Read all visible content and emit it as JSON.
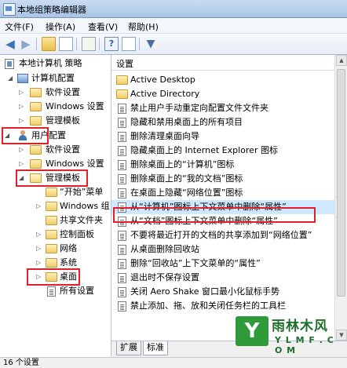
{
  "window": {
    "title": "本地组策略编辑器"
  },
  "menu": [
    "文件(F)",
    "操作(A)",
    "查看(V)",
    "帮助(H)"
  ],
  "toolbar": {
    "icons": [
      "back-arrow-icon",
      "forward-arrow-icon",
      "up-folder-icon",
      "show-hide-tree-icon",
      "export-list-icon",
      "help-icon",
      "properties-icon",
      "filter-icon"
    ]
  },
  "tree": {
    "root": "本地计算机 策略",
    "computer_config": "计算机配置",
    "cc_software": "软件设置",
    "cc_windows": "Windows 设置",
    "cc_admin": "管理模板",
    "user_config": "用户配置",
    "uc_software": "软件设置",
    "uc_windows": "Windows 设置",
    "uc_admin": "管理模板",
    "start_menu": "“开始”菜单",
    "windows_comp": "Windows 组",
    "shared_folders": "共享文件夹",
    "control_panel": "控制面板",
    "network": "网络",
    "system": "系统",
    "desktop": "桌面",
    "all_settings": "所有设置"
  },
  "list": {
    "header": "设置",
    "items": [
      {
        "label": "Active Desktop",
        "type": "folder"
      },
      {
        "label": "Active Directory",
        "type": "folder"
      },
      {
        "label": "禁止用户手动重定向配置文件文件夹",
        "type": "policy"
      },
      {
        "label": "隐藏和禁用桌面上的所有项目",
        "type": "policy"
      },
      {
        "label": "删除清理桌面向导",
        "type": "policy"
      },
      {
        "label": "隐藏桌面上的 Internet Explorer 图标",
        "type": "policy"
      },
      {
        "label": "删除桌面上的“计算机”图标",
        "type": "policy"
      },
      {
        "label": "删除桌面上的“我的文档”图标",
        "type": "policy"
      },
      {
        "label": "在桌面上隐藏“网络位置”图标",
        "type": "policy"
      },
      {
        "label": "从“计算机”图标上下文菜单中删除“属性”",
        "type": "policy",
        "selected": true
      },
      {
        "label": "从“文档”图标上下文菜单中删除“属性”",
        "type": "policy"
      },
      {
        "label": "不要将最近打开的文档的共享添加到“网络位置”",
        "type": "policy"
      },
      {
        "label": "从桌面删除回收站",
        "type": "policy"
      },
      {
        "label": "删除“回收站”上下文菜单的“属性”",
        "type": "policy"
      },
      {
        "label": "退出时不保存设置",
        "type": "policy"
      },
      {
        "label": "关闭 Aero Shake 窗口最小化鼠标手势",
        "type": "policy"
      },
      {
        "label": "禁止添加、拖、放和关闭任务栏的工具栏",
        "type": "policy"
      }
    ]
  },
  "tabs": [
    "扩展",
    "标准"
  ],
  "status": {
    "text": "16 个设置"
  },
  "watermark": {
    "mark": "Y",
    "name": "雨林木风",
    "url": "Y L M F . C O M"
  },
  "colors": {
    "highlight": "#e0202a",
    "selection": "#cde8ff"
  }
}
